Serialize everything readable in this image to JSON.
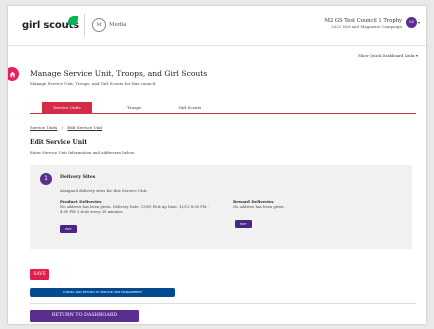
{
  "header": {
    "logo_text": "girl scouts",
    "media_monogram": "M",
    "media_label": "Media",
    "council_name": "M2 GS Test Council 1 Trophy",
    "campaign": "2022 Nut and Magazine Campaign",
    "avatar_initials": "GS"
  },
  "quick_links_label": "Show Quick Dashboard Links",
  "page": {
    "title": "Manage Service Unit, Troops, and Girl Scouts",
    "subtitle": "Manage Service Unit, Troops, and Girl Scouts for this council."
  },
  "tabs": [
    {
      "label": "Service Units"
    },
    {
      "label": "Troops"
    },
    {
      "label": "Girl Scouts"
    }
  ],
  "breadcrumb": {
    "items": [
      "Service Units",
      "Edit Service Unit"
    ],
    "separator": "/"
  },
  "section": {
    "title": "Edit Service Unit",
    "subtitle": "Enter Service Unit Information and addresses below:"
  },
  "delivery": {
    "step_number": "1",
    "title": "Delivery Sites",
    "subtitle": "Assigned delivery sites for this Service Unit.",
    "product": {
      "heading": "Product Deliveries",
      "text": "No address has been given. Delivery Date: 12/09 Pick up Date: 12/12 8:00 PM - 4:00 PM 3 slots every 30 minutes"
    },
    "reward": {
      "heading": "Reward Deliveries",
      "text": "No address has been given."
    },
    "edit_label": "EDIT"
  },
  "actions": {
    "save": "SAVE",
    "cancel": "CANCEL AND RETURN TO SERVICE UNIT MANAGEMENT",
    "dashboard": "RETURN TO DASHBOARD"
  },
  "colors": {
    "brand_pink": "#e0204a",
    "tab_red": "#d42b49",
    "purple": "#5a2d91",
    "navy": "#004a8f",
    "green_leaf": "#00b451"
  }
}
